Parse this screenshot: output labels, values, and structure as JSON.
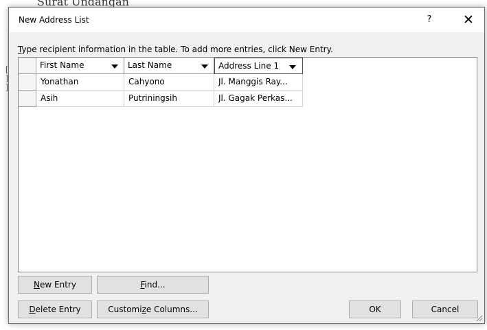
{
  "background": {
    "doc_text": "Surat Undangan",
    "margin_marks": "[\n]\n]"
  },
  "dialog": {
    "title": "New Address List",
    "help_label": "?",
    "close_label": "✕"
  },
  "instruction": {
    "first_char": "T",
    "rest": "ype recipient information in the table.  To add more entries, click New Entry."
  },
  "table": {
    "columns": [
      "First Name",
      "Last Name",
      "Address Line 1"
    ],
    "rows": [
      [
        "Yonathan",
        "Cahyono",
        "Jl. Manggis Ray..."
      ],
      [
        "Asih",
        "Putriningsih",
        "Jl. Gagak Perkas..."
      ]
    ]
  },
  "buttons": {
    "new_entry": {
      "mnemonic": "N",
      "rest": "ew Entry"
    },
    "find": {
      "mnemonic": "F",
      "rest": "ind..."
    },
    "delete_entry": {
      "mnemonic": "D",
      "rest": "elete Entry"
    },
    "customize": {
      "before": "Customi",
      "mnemonic": "z",
      "after": "e Columns..."
    },
    "ok": "OK",
    "cancel": "Cancel"
  }
}
